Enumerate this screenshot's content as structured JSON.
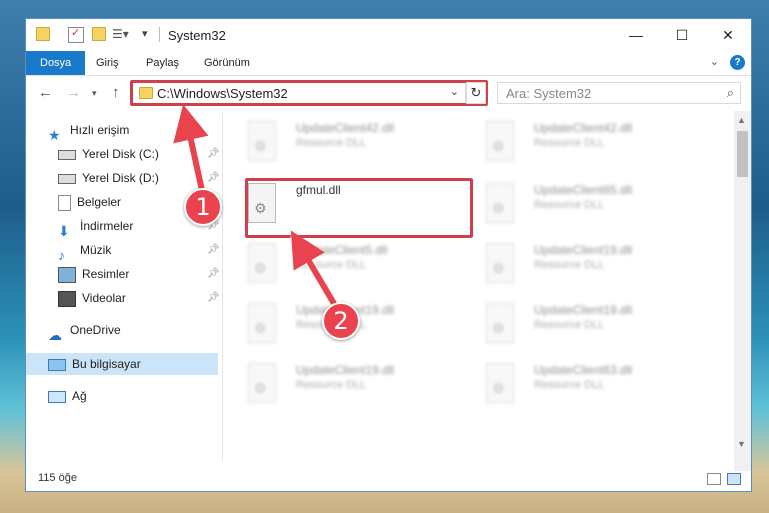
{
  "titlebar": {
    "title": "System32",
    "minimize": "—",
    "maximize": "☐",
    "close": "✕"
  },
  "ribbon": {
    "tabs": [
      "Dosya",
      "Giriş",
      "Paylaş",
      "Görünüm"
    ],
    "help": "?"
  },
  "address": {
    "path": "C:\\Windows\\System32",
    "search_placeholder": "Ara: System32"
  },
  "nav": {
    "quick_access": "Hızlı erişim",
    "items": [
      "Yerel Disk (C:)",
      "Yerel Disk (D:)",
      "Belgeler",
      "İndirmeler",
      "Müzik",
      "Resimler",
      "Videolar"
    ],
    "onedrive": "OneDrive",
    "this_pc": "Bu bilgisayar",
    "network": "Ağ"
  },
  "files": [
    {
      "name": "UpdateClient42.dll",
      "type": "Resource DLL"
    },
    {
      "name": "UpdateClient42.dll",
      "type": "Resource DLL"
    },
    {
      "name": "gfmul.dll",
      "type": ""
    },
    {
      "name": "UpdateClient65.dll",
      "type": "Resource DLL"
    },
    {
      "name": "UpdateClient5.dll",
      "type": "Resource DLL"
    },
    {
      "name": "UpdateClient19.dll",
      "type": "Resource DLL"
    },
    {
      "name": "UpdateClient19.dll",
      "type": "Resource DLL"
    },
    {
      "name": "UpdateClient19.dll",
      "type": "Resource DLL"
    },
    {
      "name": "UpdateClient19.dll",
      "type": "Resource DLL"
    },
    {
      "name": "UpdateClient63.dll",
      "type": "Resource DLL"
    }
  ],
  "status": {
    "count": "115 öğe"
  },
  "callouts": [
    "1",
    "2"
  ],
  "colors": {
    "accent": "#1979ca",
    "highlight": "#d0404a",
    "selection": "#cce4f7"
  }
}
